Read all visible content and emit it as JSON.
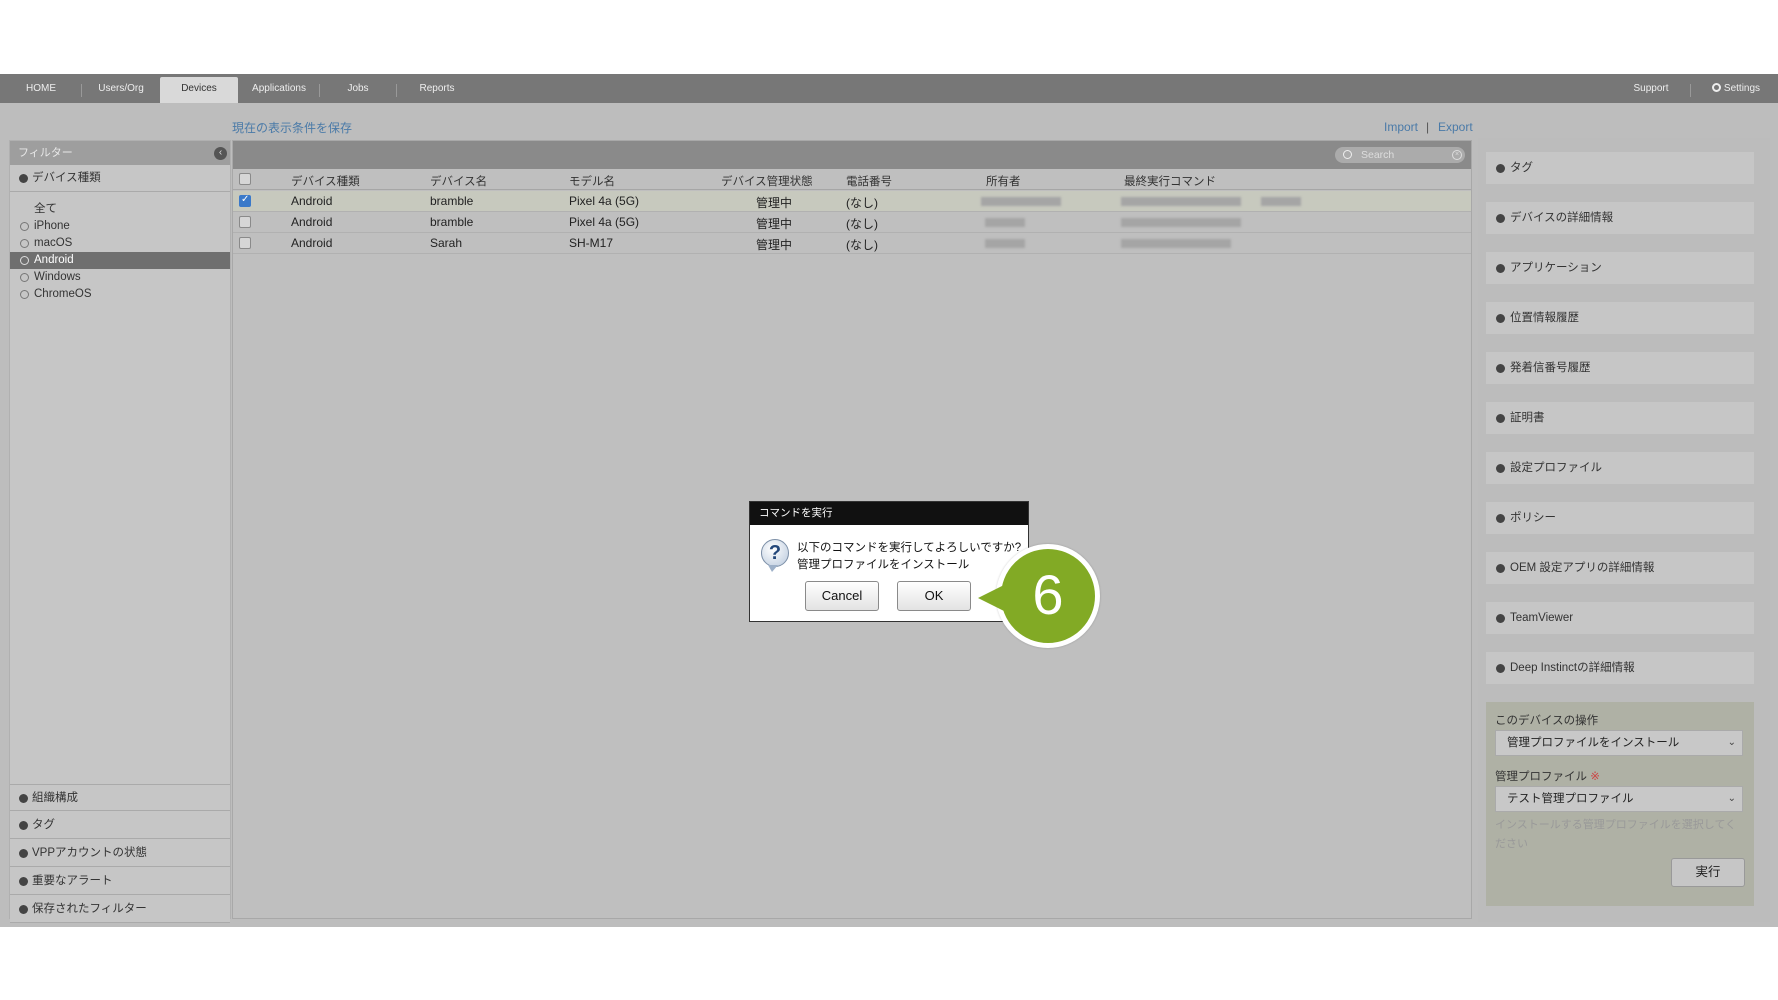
{
  "nav": {
    "tabs": [
      {
        "label": "HOME"
      },
      {
        "label": "Users/Org"
      },
      {
        "label": "Devices"
      },
      {
        "label": "Applications"
      },
      {
        "label": "Jobs"
      },
      {
        "label": "Reports"
      }
    ],
    "active_tab": "Devices",
    "support_label": "Support",
    "settings_label": "Settings"
  },
  "linkbar": {
    "save_filter": "現在の表示条件を保存",
    "import": "Import",
    "separator": "|",
    "export": "Export"
  },
  "filter": {
    "header": "フィルター",
    "device_type_section": "デバイス種類",
    "options": [
      "全て",
      "iPhone",
      "macOS",
      "Android",
      "Windows",
      "ChromeOS"
    ],
    "selected": "Android",
    "bottom_sections": [
      "組織構成",
      "タグ",
      "VPPアカウントの状態",
      "重要なアラート",
      "保存されたフィルター"
    ]
  },
  "search": {
    "placeholder": "Search"
  },
  "table": {
    "columns": [
      "デバイス種類",
      "デバイス名",
      "モデル名",
      "デバイス管理状態",
      "電話番号",
      "所有者",
      "最終実行コマンド"
    ],
    "rows": [
      {
        "checked": true,
        "type": "Android",
        "name": "bramble",
        "model": "Pixel 4a (5G)",
        "status": "管理中",
        "phone": "(なし)"
      },
      {
        "checked": false,
        "type": "Android",
        "name": "bramble",
        "model": "Pixel 4a (5G)",
        "status": "管理中",
        "phone": "(なし)"
      },
      {
        "checked": false,
        "type": "Android",
        "name": "Sarah",
        "model": "SH-M17",
        "status": "管理中",
        "phone": "(なし)"
      }
    ]
  },
  "details": {
    "sections": [
      "タグ",
      "デバイスの詳細情報",
      "アプリケーション",
      "位置情報履歴",
      "発着信番号履歴",
      "証明書",
      "設定プロファイル",
      "ポリシー",
      "OEM 設定アプリの詳細情報",
      "TeamViewer",
      "Deep Instinctの詳細情報"
    ],
    "operations": {
      "label": "このデバイスの操作",
      "action_value": "管理プロファイルをインストール",
      "profile_label": "管理プロファイル",
      "required_mark": "※",
      "profile_value": "テスト管理プロファイル",
      "hint": "インストールする管理プロファイルを選択してください",
      "run_label": "実行"
    }
  },
  "dialog": {
    "title": "コマンドを実行",
    "question": "以下のコマンドを実行してよろしいですか?",
    "command": "管理プロファイルをインストール",
    "cancel_label": "Cancel",
    "ok_label": "OK"
  },
  "annotation": {
    "step": "6",
    "color": "#82aa25"
  },
  "colors": {
    "app_bg": "#bdbdbd",
    "nav_bg": "#777777",
    "link": "#4a7aa8",
    "checkbox_on": "#3a79c9"
  }
}
